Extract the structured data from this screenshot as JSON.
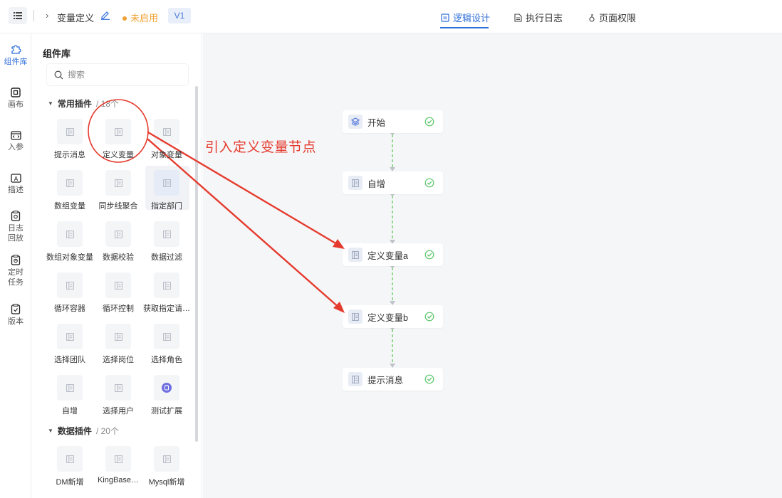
{
  "header": {
    "breadcrumb_title": "变量定义",
    "status": "未启用",
    "version": "V1",
    "tabs": [
      {
        "label": "逻辑设计",
        "icon": "design-icon",
        "active": true
      },
      {
        "label": "执行日志",
        "icon": "log-icon",
        "active": false
      },
      {
        "label": "页面权限",
        "icon": "permission-icon",
        "active": false
      }
    ]
  },
  "leftnav": [
    {
      "label": "组件库",
      "icon": "puzzle-icon",
      "active": true
    },
    {
      "label": "画布",
      "icon": "canvas-icon"
    },
    {
      "label": "入参",
      "icon": "input-param-icon"
    },
    {
      "label": "描述",
      "icon": "description-icon"
    },
    {
      "label": "日志\n回放",
      "icon": "log-replay-icon"
    },
    {
      "label": "定时\n任务",
      "icon": "scheduled-task-icon"
    },
    {
      "label": "版本",
      "icon": "version-icon"
    }
  ],
  "panel": {
    "title": "组件库",
    "search_placeholder": "搜索",
    "sections": [
      {
        "name": "常用插件",
        "count": "/ 18个",
        "items": [
          "提示消息",
          "定义变量",
          "对象变量",
          "数组变量",
          "同步线聚合",
          "指定部门",
          "数组对象变量",
          "数据校验",
          "数据过滤",
          "循环容器",
          "循环控制",
          "获取指定请…",
          "选择团队",
          "选择岗位",
          "选择角色",
          "自增",
          "选择用户",
          "测试扩展"
        ]
      },
      {
        "name": "数据插件",
        "count": "/ 20个",
        "items": [
          "DM新增",
          "KingBase…",
          "Mysql新增"
        ]
      }
    ]
  },
  "flow": {
    "nodes": [
      {
        "label": "开始",
        "icon": "layers-icon"
      },
      {
        "label": "自增",
        "icon": "component-icon"
      },
      {
        "label": "定义变量a",
        "icon": "component-icon"
      },
      {
        "label": "定义变量b",
        "icon": "component-icon"
      },
      {
        "label": "提示消息",
        "icon": "component-icon"
      }
    ],
    "annotation": "引入定义变量节点"
  },
  "colors": {
    "accent": "#2f6fd8",
    "status": "#f0a030",
    "success": "#5ac76b",
    "annotation": "#e53b2e",
    "connector": "#7fd07a"
  }
}
